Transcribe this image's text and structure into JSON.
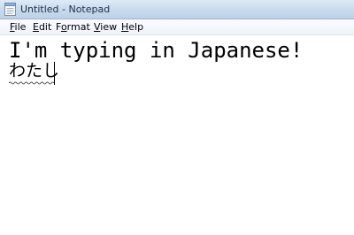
{
  "window": {
    "title": "Untitled - Notepad",
    "app_icon": "notepad-icon"
  },
  "menu": {
    "items": [
      {
        "label_accel": "F",
        "label_rest": "ile"
      },
      {
        "label_accel": "E",
        "label_rest": "dit"
      },
      {
        "label_pre": "F",
        "label_accel": "o",
        "label_rest": "rmat"
      },
      {
        "label_accel": "V",
        "label_rest": "iew"
      },
      {
        "label_accel": "H",
        "label_rest": "elp"
      }
    ]
  },
  "editor": {
    "line1": "I'm typing in Japanese!",
    "line2": "わたし",
    "composition_underline": "wavy"
  }
}
